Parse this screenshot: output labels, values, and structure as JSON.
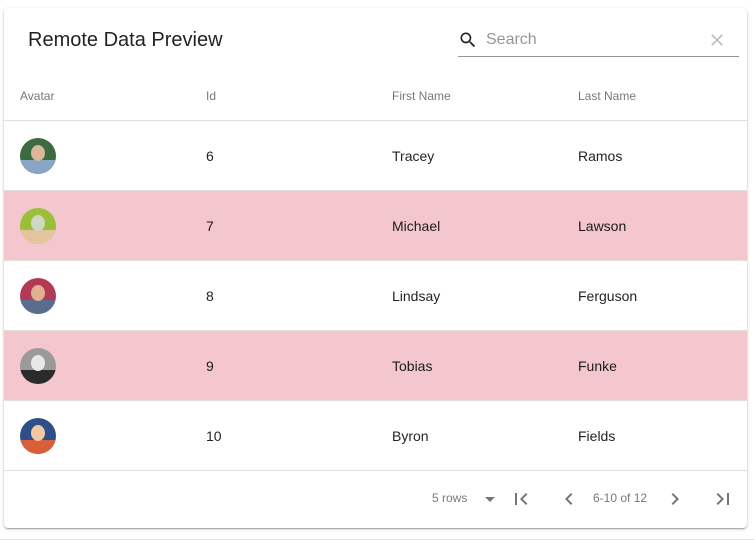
{
  "title": "Remote Data Preview",
  "search": {
    "placeholder": "Search",
    "value": "",
    "icon": "search-icon",
    "clear_icon": "close-icon"
  },
  "columns": [
    "Avatar",
    "Id",
    "First Name",
    "Last Name"
  ],
  "rows": [
    {
      "id": "6",
      "first": "Tracey",
      "last": "Ramos",
      "avatar_colors": [
        "#3b6b3f",
        "#8aa6c7",
        "#d9b79a"
      ],
      "highlighted": false
    },
    {
      "id": "7",
      "first": "Michael",
      "last": "Lawson",
      "avatar_colors": [
        "#9bbf3a",
        "#e3c49f",
        "#cfd8c0"
      ],
      "highlighted": true
    },
    {
      "id": "8",
      "first": "Lindsay",
      "last": "Ferguson",
      "avatar_colors": [
        "#b33a55",
        "#5a6d8f",
        "#e2b08e"
      ],
      "highlighted": false
    },
    {
      "id": "9",
      "first": "Tobias",
      "last": "Funke",
      "avatar_colors": [
        "#9a9a9a",
        "#2b2b2b",
        "#e8e8e8"
      ],
      "highlighted": true
    },
    {
      "id": "10",
      "first": "Byron",
      "last": "Fields",
      "avatar_colors": [
        "#2e4f8a",
        "#d95f3a",
        "#f0c9a4"
      ],
      "highlighted": false
    }
  ],
  "colors": {
    "highlight_row": "#f3c7cd",
    "divider": "#e0e0e0"
  },
  "pagination": {
    "rows_label": "5 rows",
    "range": "6-10 of 12",
    "icons": [
      "first-page-icon",
      "chevron-left-icon",
      "chevron-right-icon",
      "last-page-icon"
    ]
  }
}
